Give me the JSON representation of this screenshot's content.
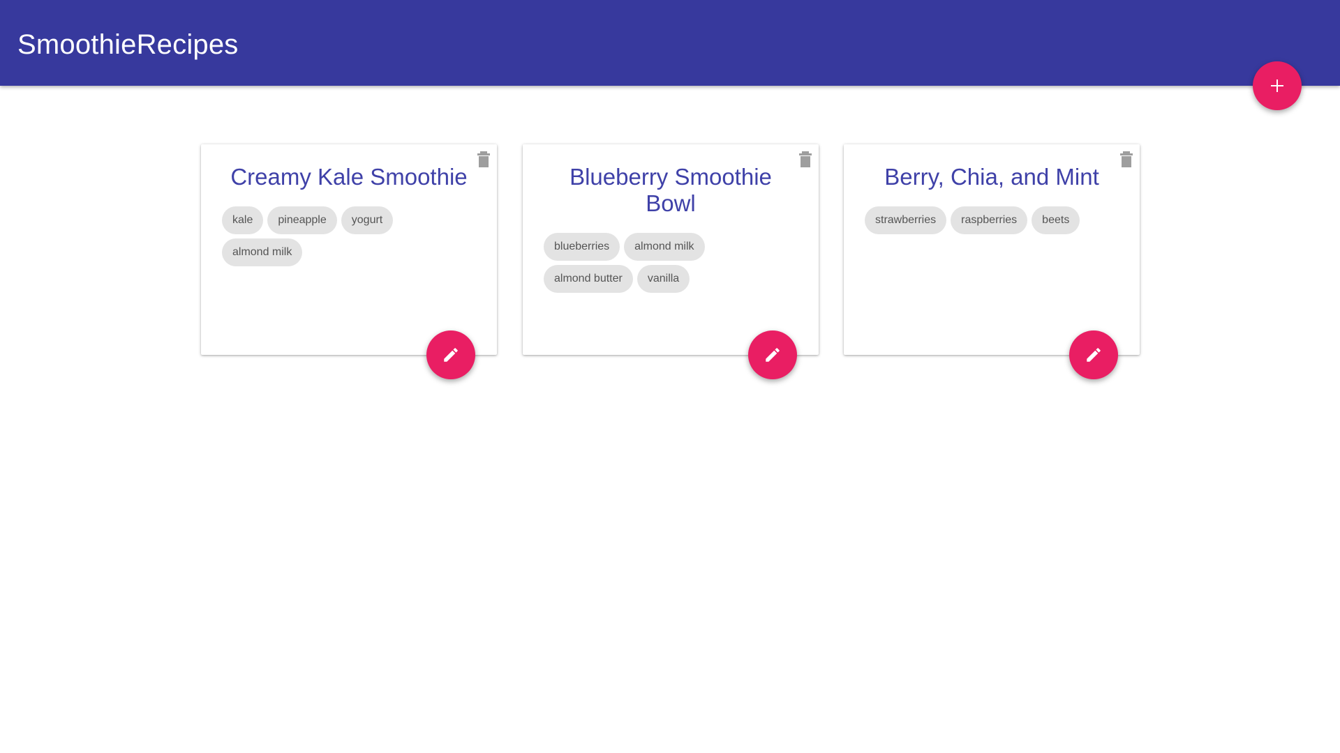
{
  "app": {
    "title": "SmoothieRecipes",
    "add_button_label": "+"
  },
  "colors": {
    "app_bar": "#37399d",
    "accent": "#e91e63",
    "card_title": "#3f41a8",
    "chip_bg": "#e3e3e3",
    "chip_text": "#555555",
    "trash_icon": "#9e9e9e"
  },
  "icons": {
    "add": "plus-icon",
    "delete": "trash-icon",
    "edit": "pencil-icon"
  },
  "recipes": [
    {
      "title": "Creamy Kale Smoothie",
      "ingredients": [
        "kale",
        "pineapple",
        "yogurt",
        "almond milk"
      ]
    },
    {
      "title": "Blueberry Smoothie Bowl",
      "ingredients": [
        "blueberries",
        "almond milk",
        "almond butter",
        "vanilla"
      ]
    },
    {
      "title": "Berry, Chia, and Mint",
      "ingredients": [
        "strawberries",
        "raspberries",
        "beets"
      ]
    }
  ]
}
